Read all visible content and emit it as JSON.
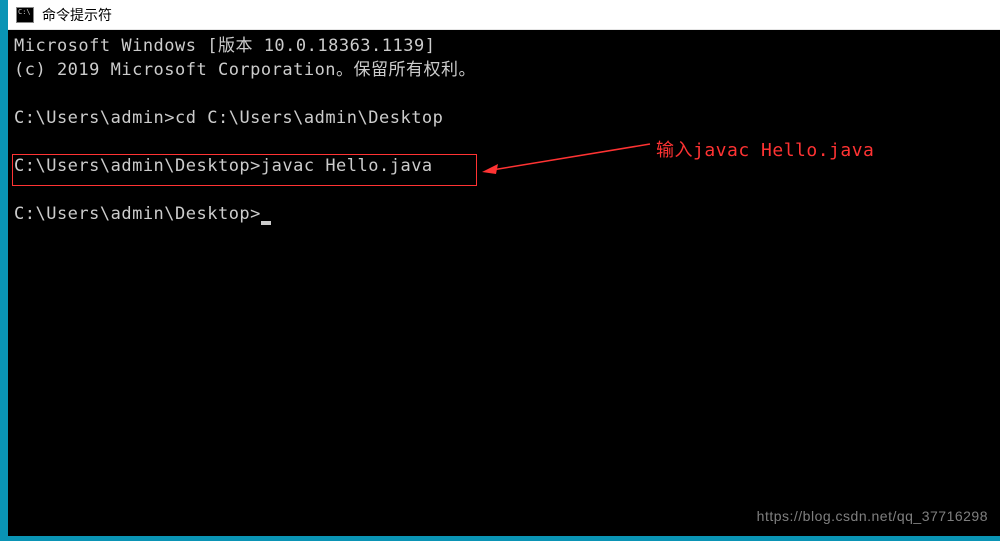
{
  "titlebar": {
    "title": "命令提示符"
  },
  "terminal": {
    "line1": "Microsoft Windows [版本 10.0.18363.1139]",
    "line2": "(c) 2019 Microsoft Corporation。保留所有权利。",
    "line3_prompt": "C:\\Users\\admin>",
    "line3_cmd": "cd C:\\Users\\admin\\Desktop",
    "line4_prompt": "C:\\Users\\admin\\Desktop>",
    "line4_cmd": "javac Hello.java",
    "line5_prompt": "C:\\Users\\admin\\Desktop>"
  },
  "annotation": {
    "text": "输入javac Hello.java"
  },
  "watermark": {
    "text": "https://blog.csdn.net/qq_37716298"
  }
}
